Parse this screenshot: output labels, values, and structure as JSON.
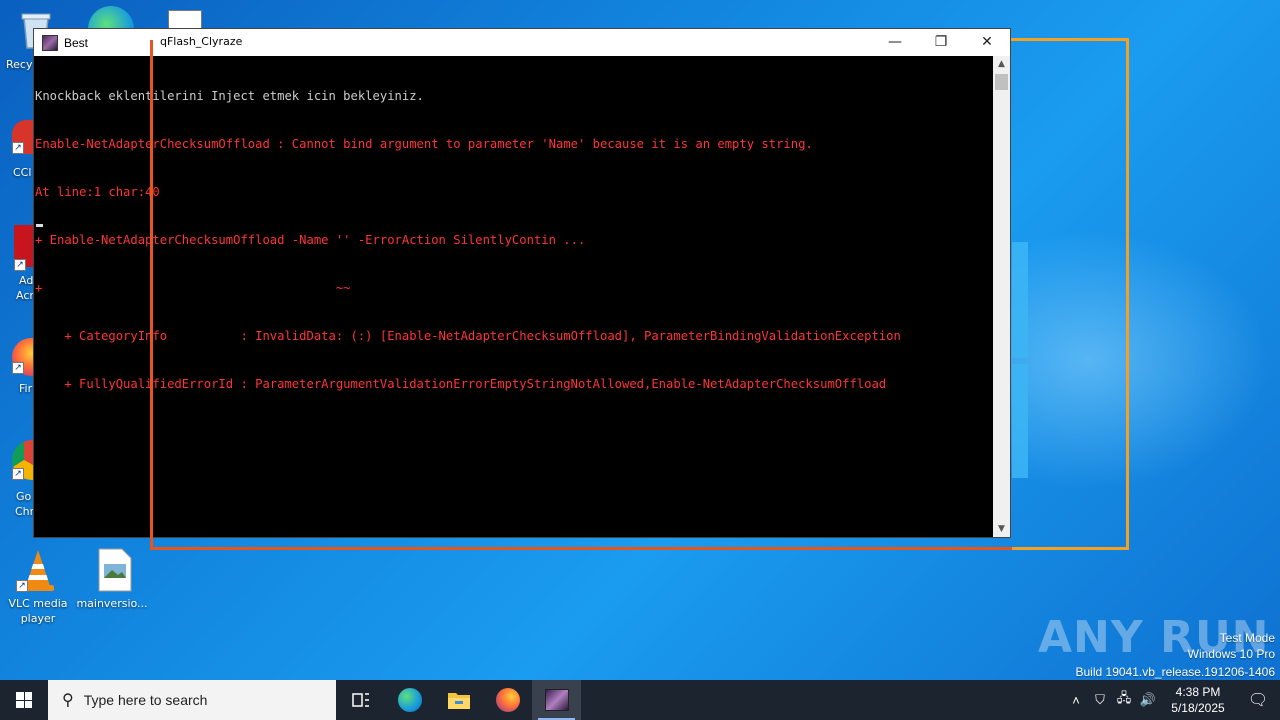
{
  "desktop": {
    "icons": [
      {
        "label": "VLC media player",
        "icon": "vlc-cone-icon"
      },
      {
        "label": "mainversio...",
        "icon": "image-file-icon"
      }
    ],
    "partial_icons": [
      {
        "label": "Recy",
        "icon": "recycle-bin-icon"
      },
      {
        "label": "CCl",
        "icon": "ccleaner-icon"
      },
      {
        "label": "Ad",
        "label2": "Acr",
        "icon": "acrobat-icon"
      },
      {
        "label": "Fir",
        "icon": "firefox-icon"
      },
      {
        "label": "Go",
        "label2": "Chr",
        "icon": "chrome-icon"
      }
    ]
  },
  "console": {
    "title": "Best",
    "lines": [
      {
        "text": "Knockback eklentilerini Inject etmek icin bekleyiniz.",
        "color": "white"
      },
      {
        "text": "Enable-NetAdapterChecksumOffload : Cannot bind argument to parameter 'Name' because it is an empty string.",
        "color": "red"
      },
      {
        "text": "At line:1 char:40",
        "color": "red"
      },
      {
        "text": "+ Enable-NetAdapterChecksumOffload -Name '' -ErrorAction SilentlyContin ...",
        "color": "red"
      },
      {
        "text": "+                                        ~~",
        "color": "red"
      },
      {
        "text": "    + CategoryInfo          : InvalidData: (:) [Enable-NetAdapterChecksumOffload], ParameterBindingValidationException",
        "color": "red"
      },
      {
        "text": "    + FullyQualifiedErrorId : ParameterArgumentValidationErrorEmptyStringNotAllowed,Enable-NetAdapterChecksumOffload",
        "color": "red"
      }
    ]
  },
  "window2": {
    "title": "qFlash_Clyraze"
  },
  "watermark": {
    "brand": "ANY RUN",
    "test_mode": "Test Mode",
    "edition": "Windows 10 Pro",
    "build": "Build 19041.vb_release.191206-1406"
  },
  "taskbar": {
    "search_placeholder": "Type here to search",
    "apps": [
      {
        "icon": "task-view-icon"
      },
      {
        "icon": "edge-icon"
      },
      {
        "icon": "file-explorer-icon"
      },
      {
        "icon": "firefox-icon"
      },
      {
        "icon": "best-app-icon",
        "active": true
      }
    ],
    "time": "4:38 PM",
    "date": "5/18/2025"
  },
  "colors": {
    "console_red": "#ff3434",
    "console_white": "#cccccc",
    "frame_orange": "#f5a020",
    "frame_red": "#e8541e",
    "taskbar_bg": "#1c2430"
  }
}
